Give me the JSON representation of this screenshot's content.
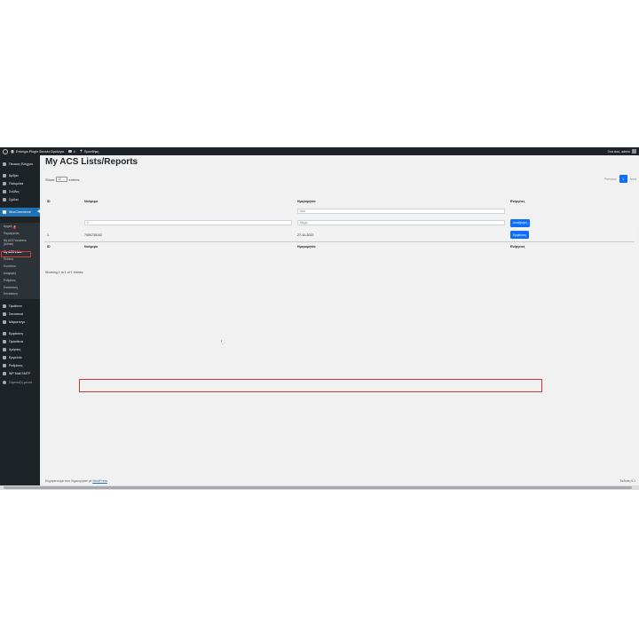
{
  "adminbar": {
    "site_name": "Επίσημο Plugin Skroutz Ωρολόγια",
    "comments_count": "0",
    "new_label": "Προσθήκη",
    "user_greeting": "Γεια σου, admin"
  },
  "sidebar": {
    "dashboard": "Πίνακας Ελέγχου",
    "posts": "Άρθρα",
    "media": "Πολυμέσα",
    "pages": "Σελίδες",
    "comments": "Σχόλια",
    "woocommerce": "WooCommerce",
    "submenu": {
      "home": "Αρχική",
      "home_badge": "1",
      "orders": "Παραγγελίες",
      "acs_vouchers": "My ACS Vouchers",
      "acs_vouchers_2": "(Admin)",
      "acs_lists": "My ACS Lists",
      "customers": "Πελάτες",
      "coupons": "Κουπόνια",
      "reports": "Αναφορές",
      "settings": "Ρυθμίσεις",
      "status": "Κατάσταση",
      "extensions": "Επεκτάσεις"
    },
    "products": "Προϊόντα",
    "analytics": "Στατιστικά",
    "marketing": "Μάρκετινγκ",
    "appearance": "Εμφάνιση",
    "plugins": "Πρόσθετα",
    "users": "Χρήστες",
    "tools": "Εργαλεία",
    "settings": "Ρυθμίσεις",
    "wp_mail": "WP Mail SMTP",
    "collapse": "Σύμπτυξη μενού"
  },
  "main": {
    "title": "My ACS Lists/Reports",
    "show_label": "Show",
    "entries_label": "entries",
    "length_value": "10",
    "pagination": {
      "previous": "Previous",
      "current": "1",
      "next": "Next"
    },
    "columns": {
      "id": "ID",
      "number": "Νούμερο",
      "date": "Ημερομηνία",
      "action": "Ενέργειες"
    },
    "filters": {
      "date_from_placeholder": "Από",
      "number_placeholder": "#",
      "date_to_placeholder": "Μέχρι",
      "search_button": "Αναζήτηση"
    },
    "rows": [
      {
        "id": "1",
        "number": "7400735102",
        "date": "27-10-2022",
        "action": "Εμφάνιση"
      }
    ],
    "info": "Showing 1 to 1 of 1 entries"
  },
  "footer": {
    "thanks_prefix": "Ευχαριστούμε που δημιουργείτε με ",
    "wordpress_link": "WordPress",
    "version": "Έκδοση 6.1"
  }
}
